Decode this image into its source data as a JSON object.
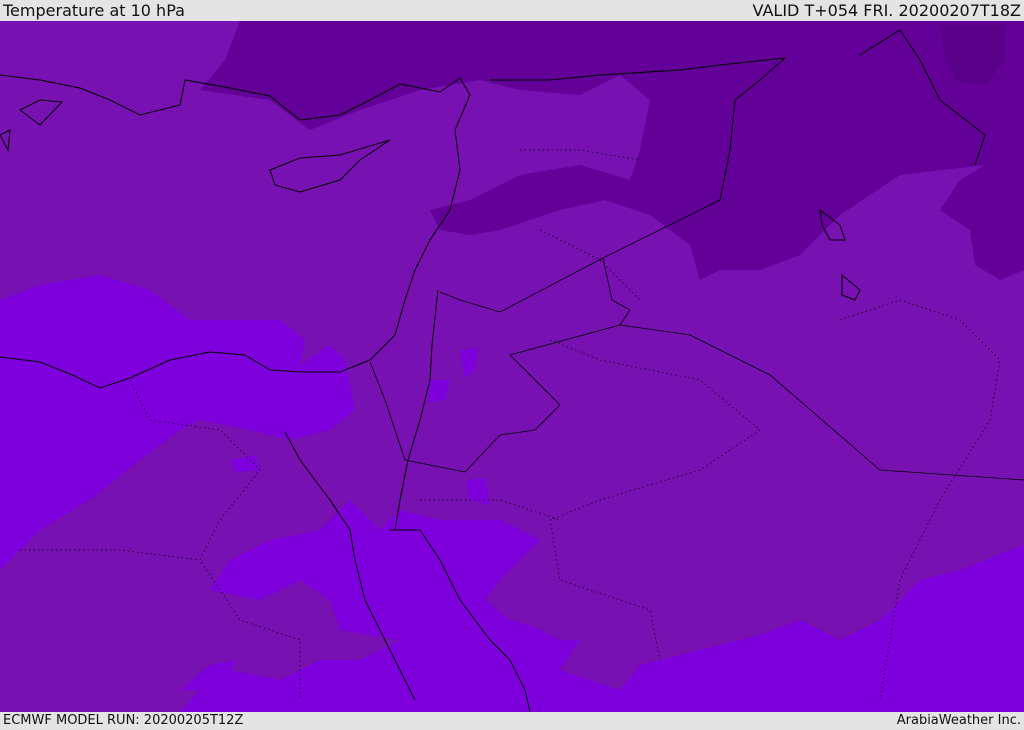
{
  "header": {
    "title": "Temperature at 10 hPa",
    "valid_time": "VALID T+054 FRI. 20200207T18Z"
  },
  "footer": {
    "model_run": "ECMWF MODEL RUN: 20200205T12Z",
    "credit": "ArabiaWeather Inc."
  },
  "colors": {
    "level_mid": "#7811b2",
    "level_cold": "#620098",
    "level_warm": "#7e00dc",
    "coastline": "#000000"
  }
}
